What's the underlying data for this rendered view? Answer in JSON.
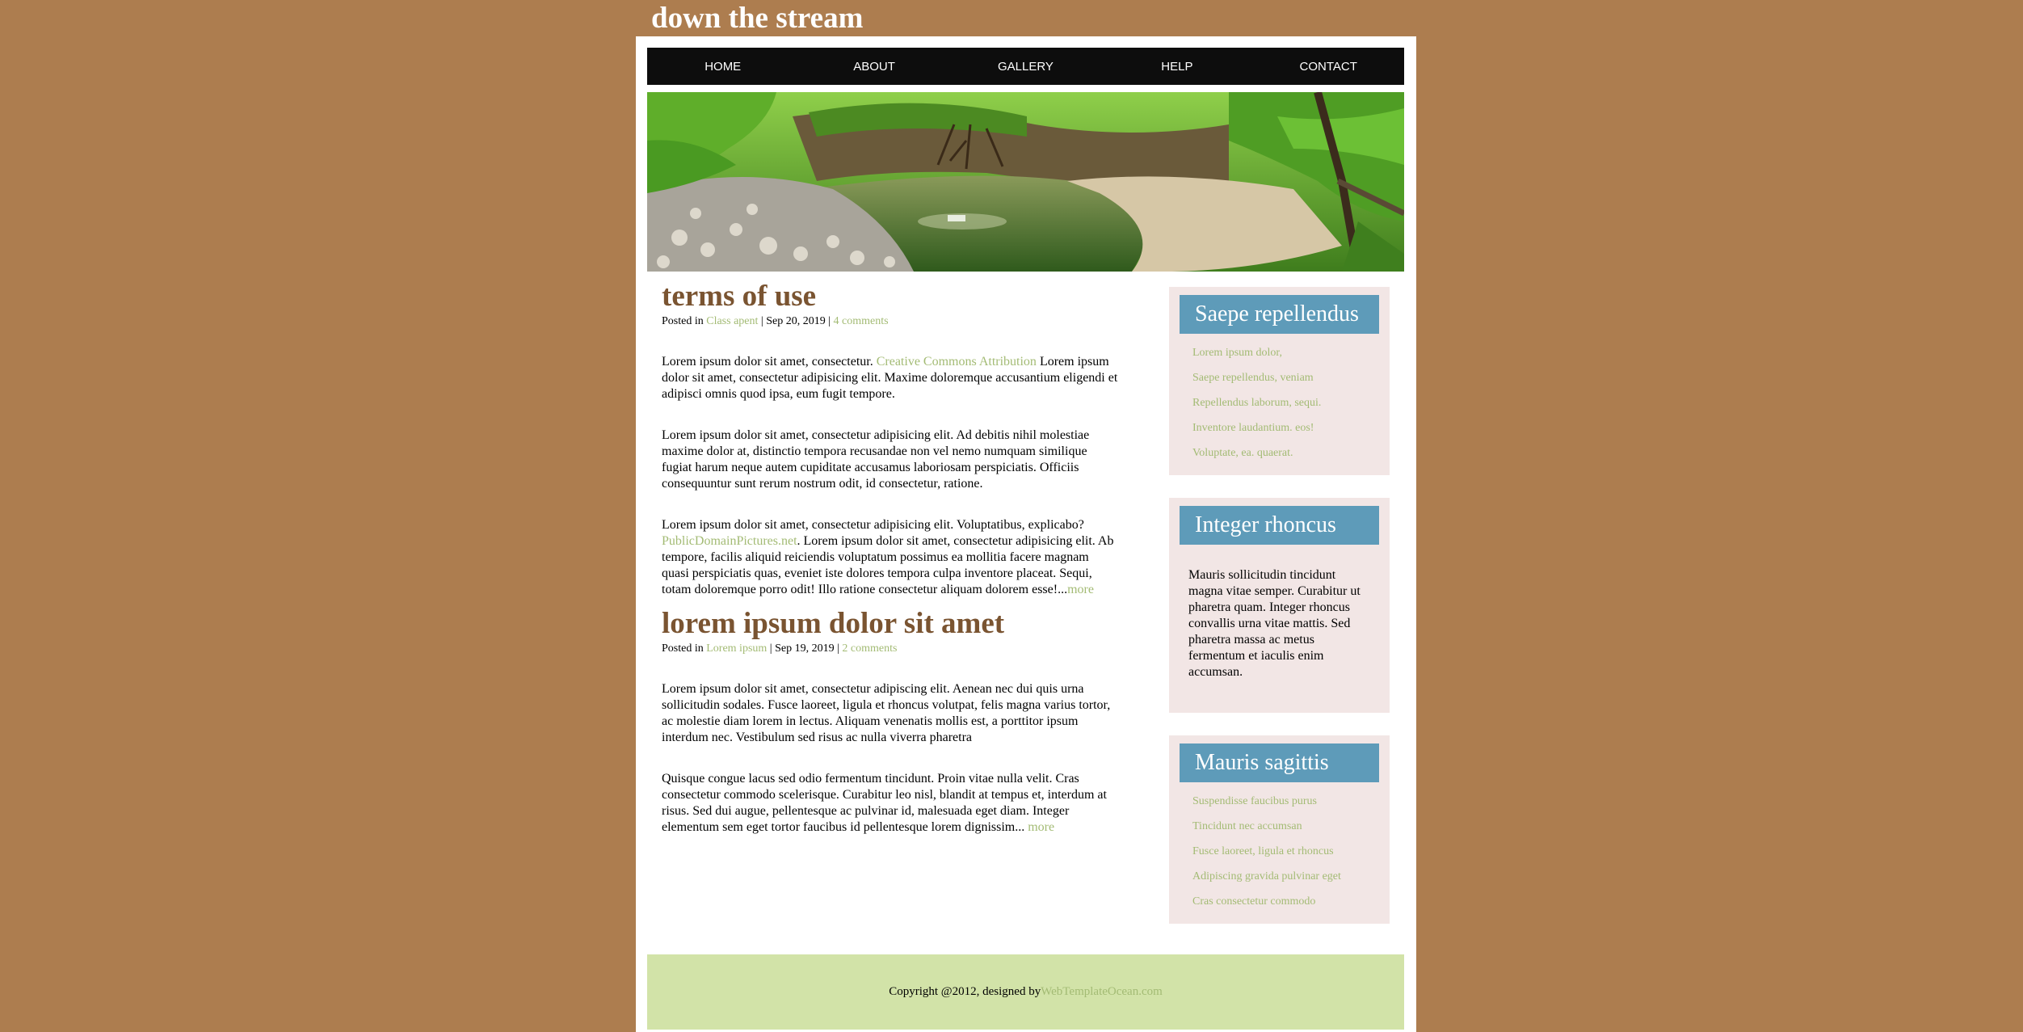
{
  "site": {
    "title": "down the stream"
  },
  "nav": {
    "items": [
      "HOME",
      "ABOUT",
      "GALLERY",
      "HELP",
      "CONTACT"
    ]
  },
  "posts": [
    {
      "title": "terms of use",
      "meta": {
        "posted_in": "Posted in",
        "category": "Class apent",
        "sep1": " | ",
        "date": "Sep 20, 2019",
        "sep2": " | ",
        "comments": "4 comments"
      },
      "p1_before": "Lorem ipsum dolor sit amet, consectetur. ",
      "p1_link": "Creative Commons Attribution",
      "p1_after": " Lorem ipsum dolor sit amet, consectetur adipisicing elit. Maxime doloremque accusantium eligendi et adipisci omnis quod ipsa, eum fugit tempore.",
      "p2": "Lorem ipsum dolor sit amet, consectetur adipisicing elit. Ad debitis nihil molestiae maxime dolor at, distinctio tempora recusandae non vel nemo numquam similique fugiat harum neque autem cupiditate accusamus laboriosam perspiciatis. Officiis consequuntur sunt rerum nostrum odit, id consectetur, ratione.",
      "p3_before": "Lorem ipsum dolor sit amet, consectetur adipisicing elit. Voluptatibus, explicabo? ",
      "p3_link": "PublicDomainPictures.net",
      "p3_after": ". Lorem ipsum dolor sit amet, consectetur adipisicing elit. Ab tempore, facilis aliquid reiciendis voluptatum possimus ea mollitia facere magnam quasi perspiciatis quas, eveniet iste dolores tempora culpa inventore placeat. Sequi, totam doloremque porro odit! Illo ratione consectetur aliquam dolorem esse!...",
      "more": "more"
    },
    {
      "title": "lorem ipsum dolor sit amet",
      "meta": {
        "posted_in": "Posted in",
        "category": "Lorem ipsum",
        "sep1": " | ",
        "date": "Sep 19, 2019",
        "sep2": " | ",
        "comments": "2 comments"
      },
      "p1": "Lorem ipsum dolor sit amet, consectetur adipiscing elit. Aenean nec dui quis urna sollicitudin sodales. Fusce laoreet, ligula et rhoncus volutpat, felis magna varius tortor, ac molestie diam lorem in lectus. Aliquam venenatis mollis est, a porttitor ipsum interdum nec. Vestibulum sed risus ac nulla viverra pharetra",
      "p2": "Quisque congue lacus sed odio fermentum tincidunt. Proin vitae nulla velit. Cras consectetur commodo scelerisque. Curabitur leo nisl, blandit at tempus et, interdum at risus. Sed dui augue, pellentesque ac pulvinar id, malesuada eget diam. Integer elementum sem eget tortor faucibus id pellentesque lorem dignissim... ",
      "more": "more"
    }
  ],
  "sidebar": {
    "widget1": {
      "title": "Saepe repellendus",
      "links": [
        "Lorem ipsum dolor,",
        "Saepe repellendus, veniam",
        "Repellendus laborum, sequi.",
        "Inventore laudantium. eos!",
        "Voluptate, ea. quaerat."
      ]
    },
    "widget2": {
      "title": "Integer rhoncus",
      "text": "Mauris sollicitudin tincidunt magna vitae semper. Curabitur ut pharetra quam. Integer rhoncus convallis urna vitae mattis. Sed pharetra massa ac metus fermentum et iaculis enim accumsan."
    },
    "widget3": {
      "title": "Mauris sagittis",
      "links": [
        "Suspendisse faucibus purus",
        "Tincidunt nec accumsan",
        "Fusce laoreet, ligula et rhoncus",
        "Adipiscing gravida pulvinar eget",
        "Cras consectetur commodo"
      ]
    }
  },
  "footer": {
    "text": "Copyright @2012, designed by",
    "link": "WebTemplateOcean.com"
  },
  "colors": {
    "background": "#ad7d4f",
    "title_brown": "#7a5431",
    "link_green": "#a3bb74",
    "widget_blue": "#5e9bb9",
    "footer_green": "#d2e3a8"
  }
}
